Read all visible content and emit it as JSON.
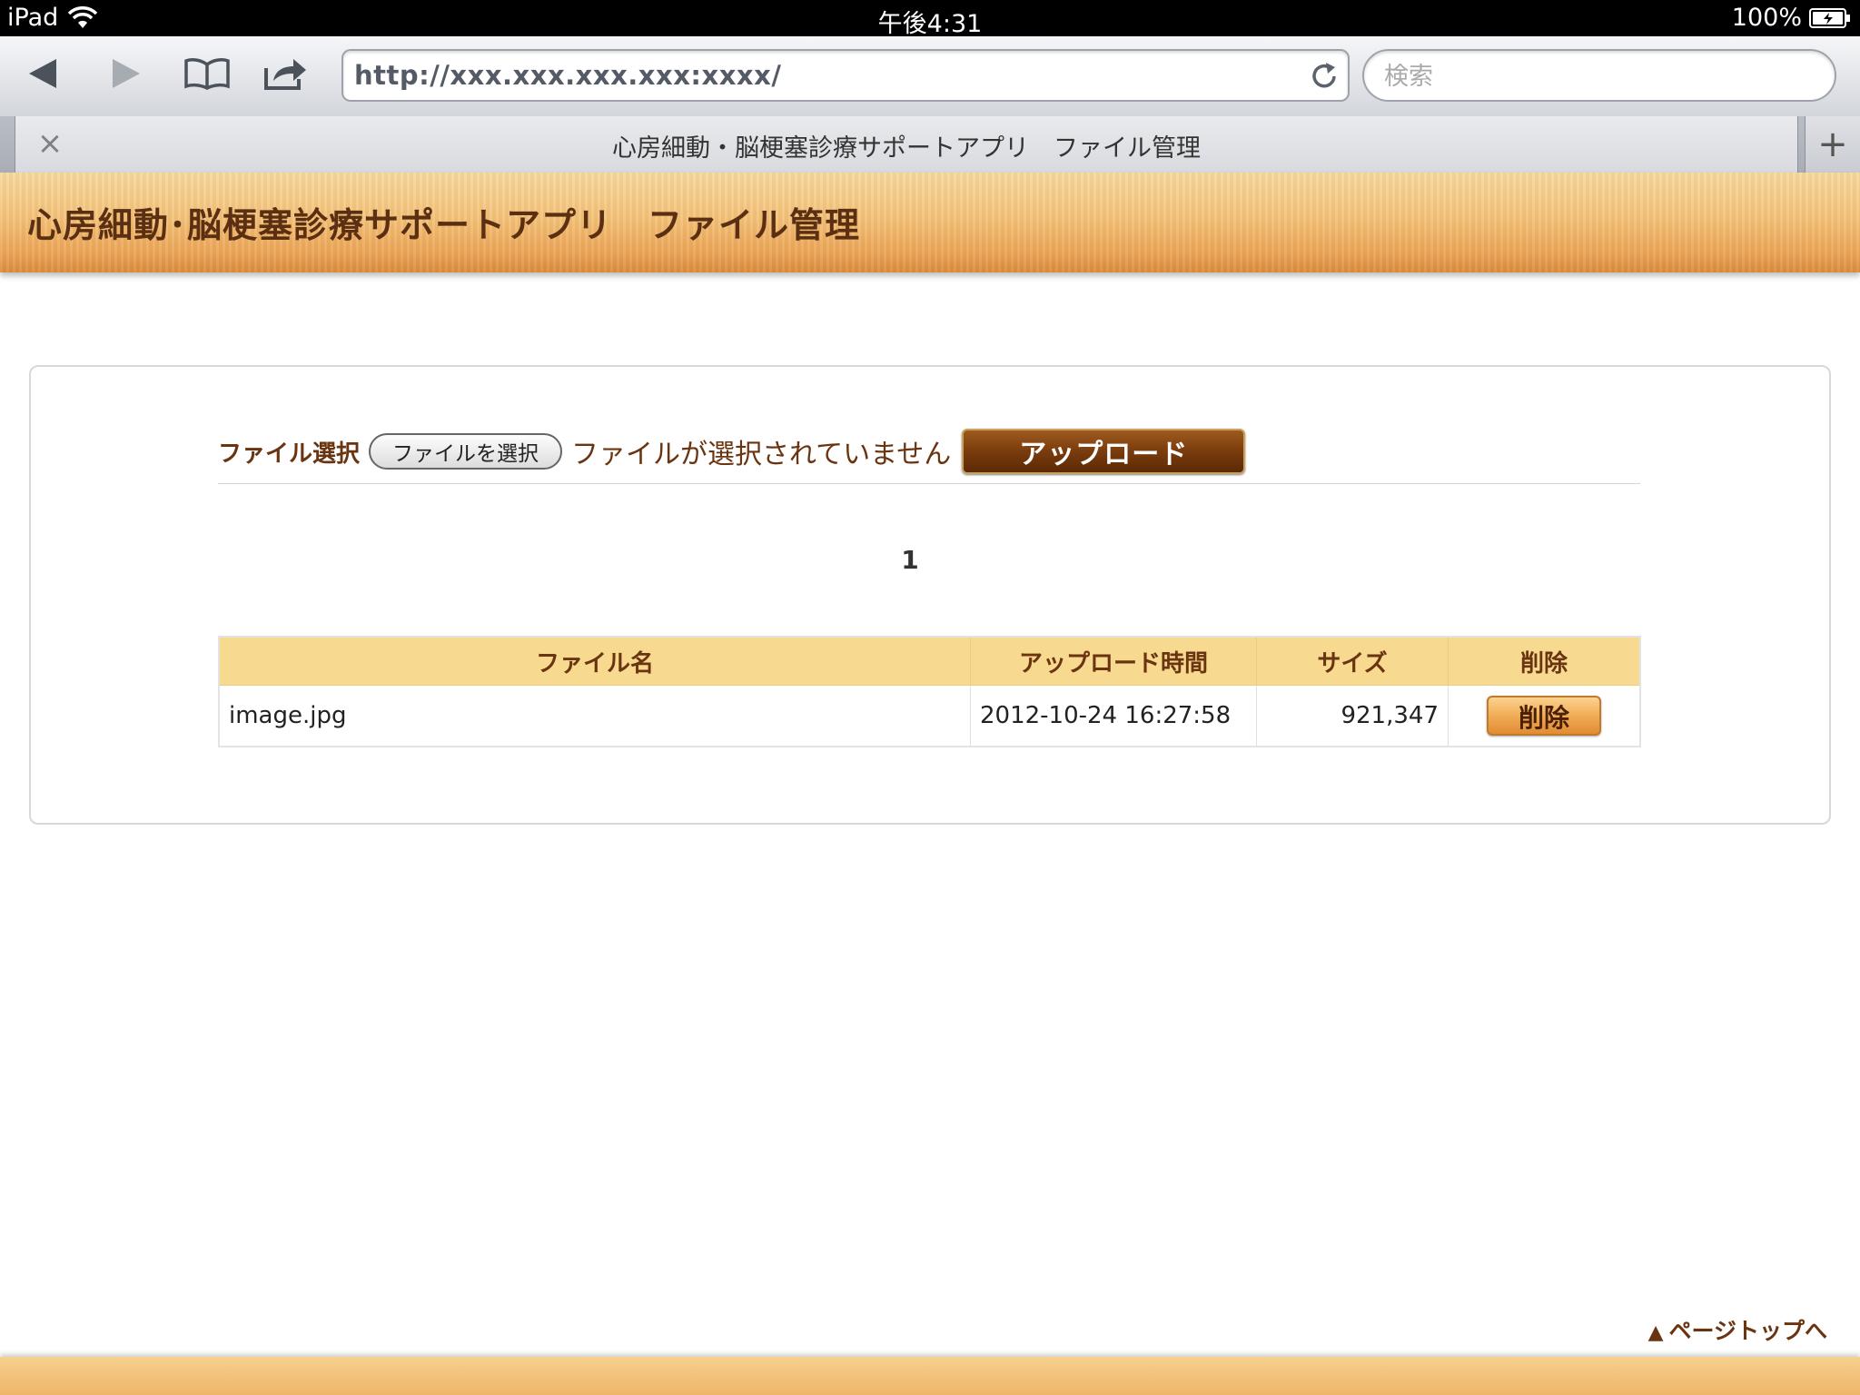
{
  "status_bar": {
    "device": "iPad",
    "time": "午後4:31",
    "battery": "100%"
  },
  "browser": {
    "url": "http://xxx.xxx.xxx.xxx:xxxx/",
    "search_placeholder": "検索",
    "tab_title": "心房細動・脳梗塞診療サポートアプリ　ファイル管理",
    "tab_close": "×",
    "tab_add": "+"
  },
  "page": {
    "title": "心房細動･脳梗塞診療サポートアプリ　ファイル管理",
    "upload": {
      "label": "ファイル選択",
      "choose_button": "ファイルを選択",
      "no_file_text": "ファイルが選択されていません",
      "upload_button": "アップロード"
    },
    "pagination": "1",
    "table": {
      "headers": [
        "ファイル名",
        "アップロード時間",
        "サイズ",
        "削除"
      ],
      "rows": [
        {
          "name": "image.jpg",
          "uploaded": "2012-10-24 16:27:58",
          "size": "921,347",
          "delete_label": "削除"
        }
      ]
    },
    "page_top_link": "ページトップへ",
    "page_top_symbol": "▲"
  },
  "colors": {
    "header_gold": "#f3c27a",
    "brown_text": "#6a3411",
    "table_header": "#f7da8f"
  }
}
